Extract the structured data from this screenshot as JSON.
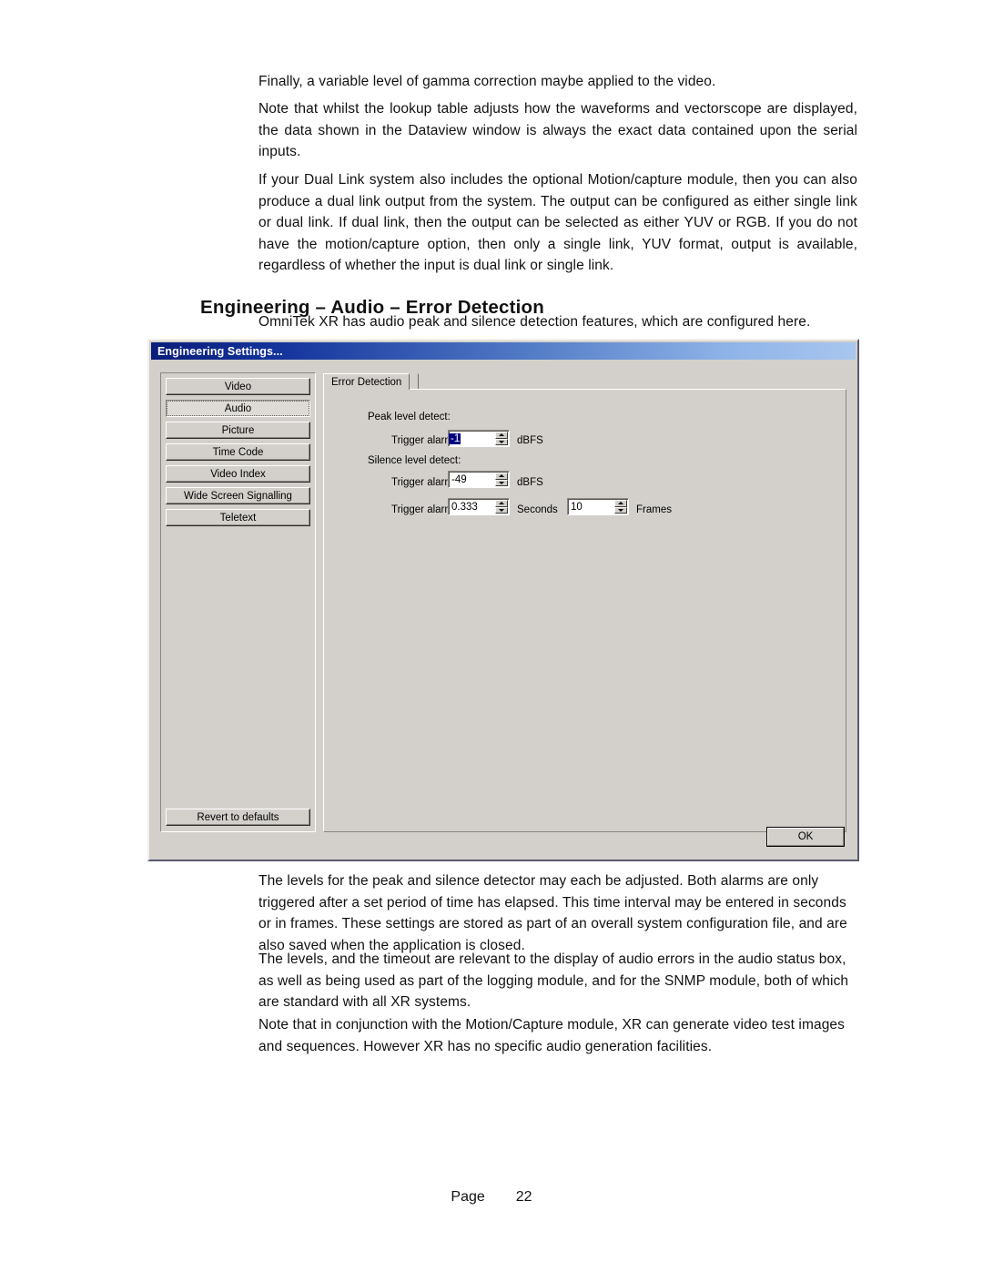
{
  "document": {
    "paragraphs": [
      "Finally, a variable level of gamma correction maybe applied to the video.",
      "Note that whilst the lookup table adjusts how the waveforms and vectorscope are displayed, the data shown in the Dataview window is always the exact data contained upon the serial inputs.",
      "If your Dual Link system also includes the optional Motion/capture module, then you can also produce a dual link output from the system.  The output can be configured as either single link or dual link.  If dual link, then the output can be selected as either YUV or RGB.  If you do not have the motion/capture option, then only a single link, YUV format, output is available, regardless of whether the input is dual link or single link."
    ],
    "heading": "Engineering – Audio – Error Detection",
    "intro": "OmniTek XR has audio peak and silence detection features, which are configured here.",
    "paragraphs_after": [
      "The levels for the peak and silence detector may each be adjusted.  Both alarms are only triggered after a set period of time has elapsed.  This time interval may be entered in seconds or in frames.  These settings are stored as part of an overall system configuration file, and are also saved when the application is closed.",
      "The levels, and the timeout are relevant to the display of audio errors in the audio status box, as well as being used as part of the logging module, and for the SNMP module, both of which are standard with all XR systems.",
      "Note that in conjunction with the Motion/Capture module, XR can generate video test images and sequences.  However XR has no specific audio generation facilities."
    ],
    "footer": {
      "label": "Page",
      "number": "22"
    }
  },
  "dialog": {
    "title": "Engineering Settings...",
    "title_bar_color_start": "#0a1d7a",
    "title_bar_color_end": "#a8c6ee",
    "background_color": "#d3d0cb",
    "nav_items": [
      {
        "label": "Video",
        "selected": false
      },
      {
        "label": "Audio",
        "selected": true
      },
      {
        "label": "Picture",
        "selected": false
      },
      {
        "label": "Time Code",
        "selected": false
      },
      {
        "label": "Video Index",
        "selected": false
      },
      {
        "label": "Wide Screen Signalling",
        "selected": false
      },
      {
        "label": "Teletext",
        "selected": false
      }
    ],
    "revert_label": "Revert to defaults",
    "tabs": [
      {
        "label": "Error Detection",
        "active": true
      }
    ],
    "form": {
      "peak_group_label": "Peak level detect:",
      "peak_trigger_label": "Trigger alarm at:",
      "peak_trigger_value": "-1",
      "peak_trigger_unit": "dBFS",
      "silence_group_label": "Silence level detect:",
      "silence_trigger_label": "Trigger alarm at:",
      "silence_trigger_value": "-49",
      "silence_trigger_unit": "dBFS",
      "after_label": "Trigger alarm after:",
      "after_seconds_value": "0.333",
      "after_seconds_unit": "Seconds",
      "after_frames_value": "10",
      "after_frames_unit": "Frames"
    },
    "ok_label": "OK"
  }
}
